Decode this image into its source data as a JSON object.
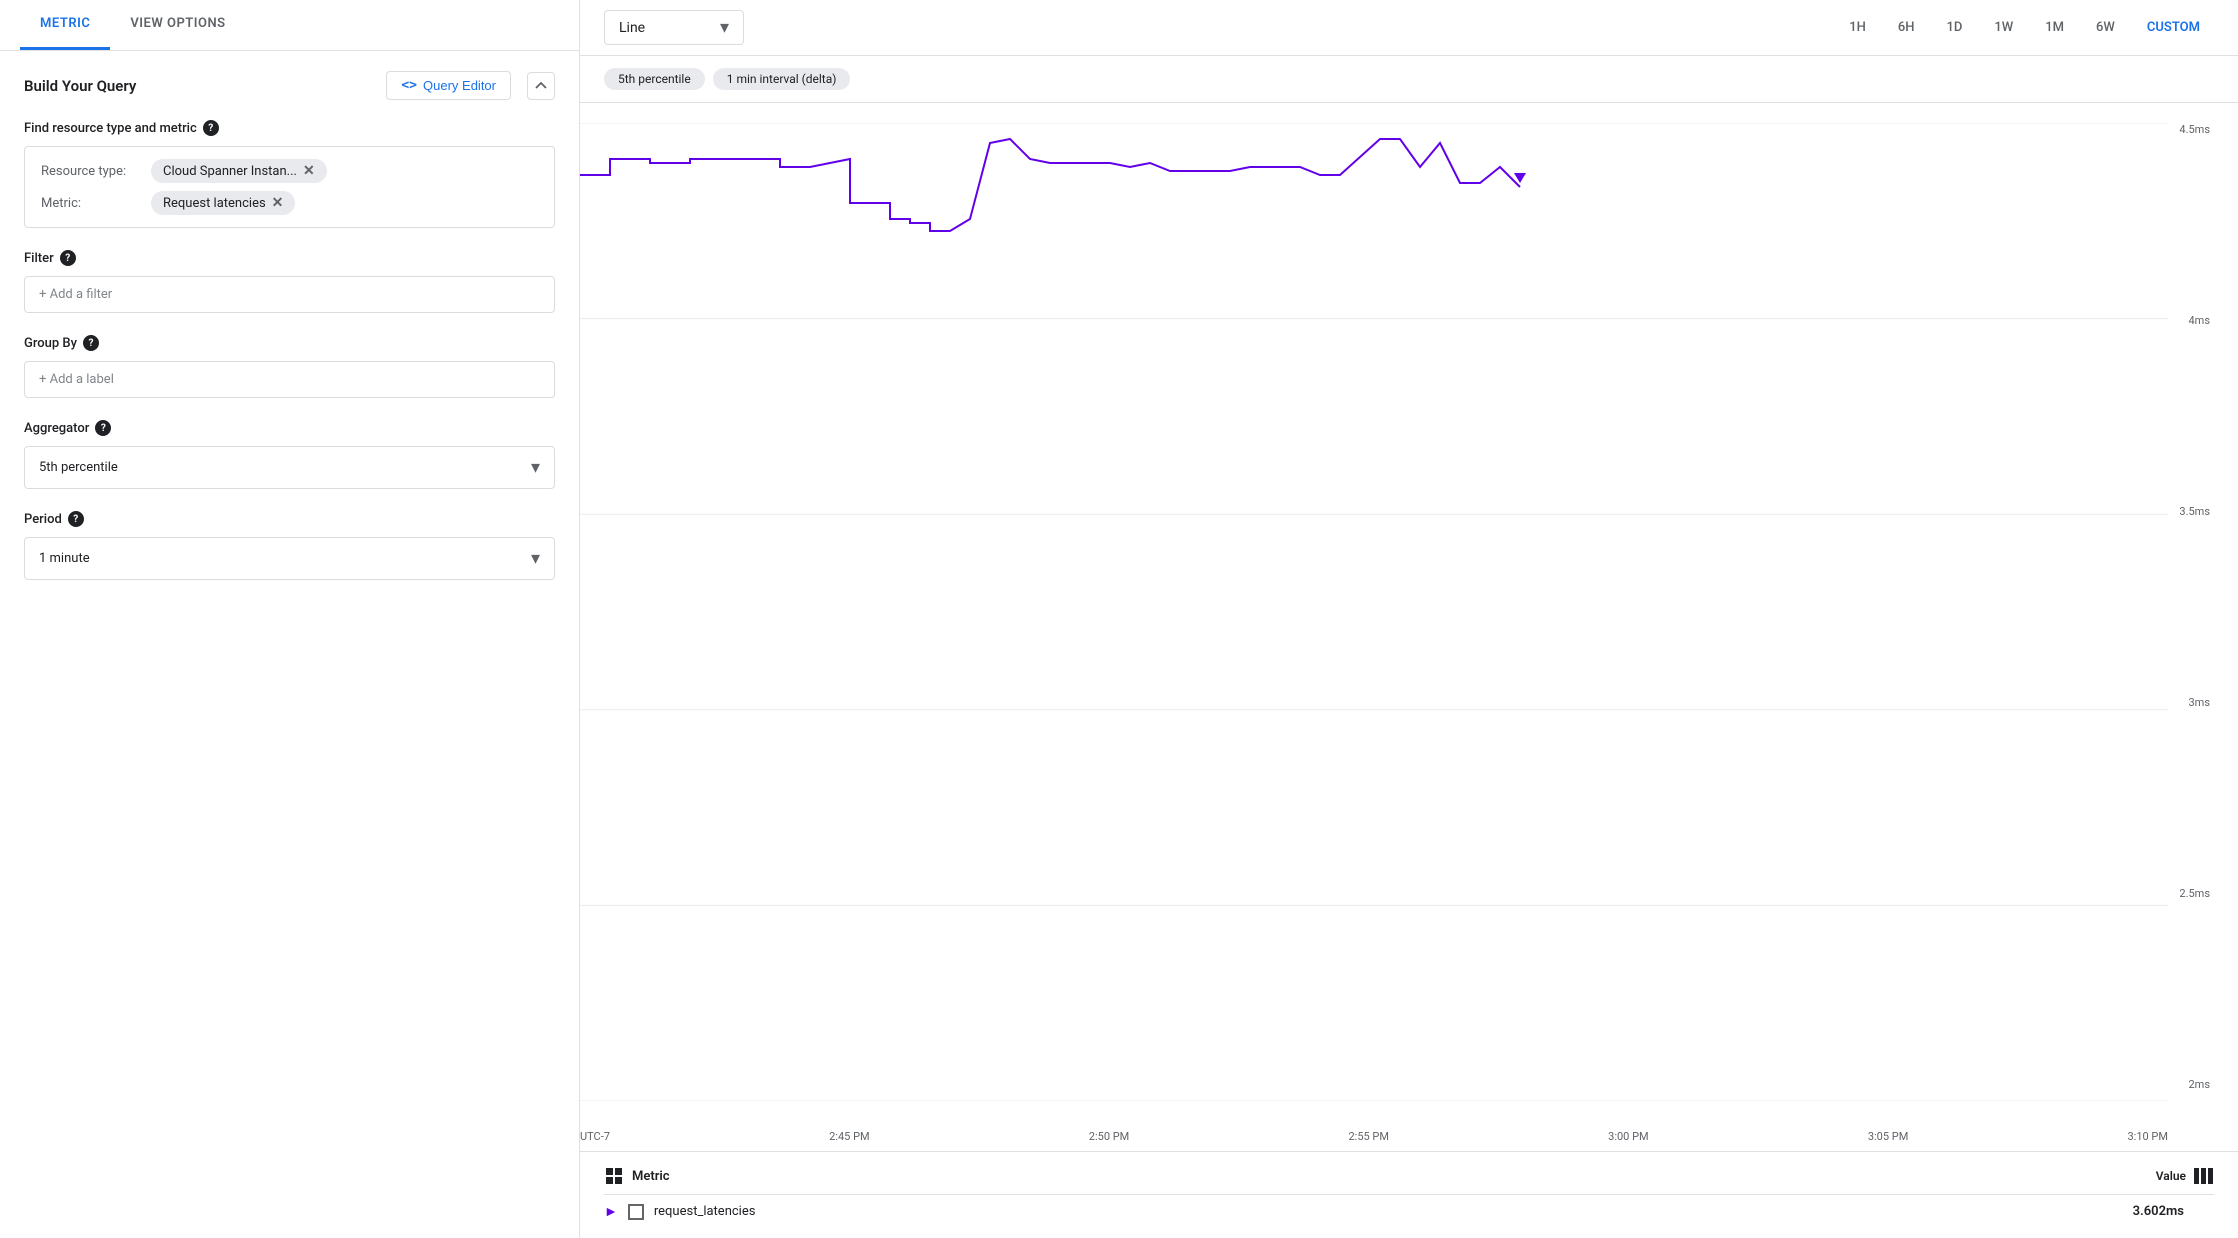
{
  "tabs": {
    "metric": "METRIC",
    "view_options": "VIEW OPTIONS"
  },
  "left": {
    "build_query_title": "Build Your Query",
    "query_editor_btn": "Query Editor",
    "sections": {
      "find_resource": {
        "label": "Find resource type and metric",
        "resource_type_label": "Resource type:",
        "resource_type_value": "Cloud Spanner Instan...",
        "metric_label": "Metric:",
        "metric_value": "Request latencies"
      },
      "filter": {
        "label": "Filter",
        "placeholder": "+ Add a filter"
      },
      "group_by": {
        "label": "Group By",
        "placeholder": "+ Add a label"
      },
      "aggregator": {
        "label": "Aggregator",
        "value": "5th percentile"
      },
      "period": {
        "label": "Period",
        "value": "1 minute"
      }
    }
  },
  "right": {
    "chart_type": "Line",
    "time_buttons": [
      "1H",
      "6H",
      "1D",
      "1W",
      "1M",
      "6W",
      "CUSTOM"
    ],
    "active_time": "CUSTOM",
    "filter_chips": [
      "5th percentile",
      "1 min interval (delta)"
    ],
    "y_axis": [
      "4.5ms",
      "4ms",
      "3.5ms",
      "3ms",
      "2.5ms",
      "2ms"
    ],
    "x_axis": [
      "UTC-7",
      "2:45 PM",
      "2:50 PM",
      "2:55 PM",
      "3:00 PM",
      "3:05 PM",
      "3:10 PM"
    ],
    "legend": {
      "metric_col": "Metric",
      "value_col": "Value",
      "rows": [
        {
          "name": "request_latencies",
          "value": "3.602ms"
        }
      ]
    }
  }
}
